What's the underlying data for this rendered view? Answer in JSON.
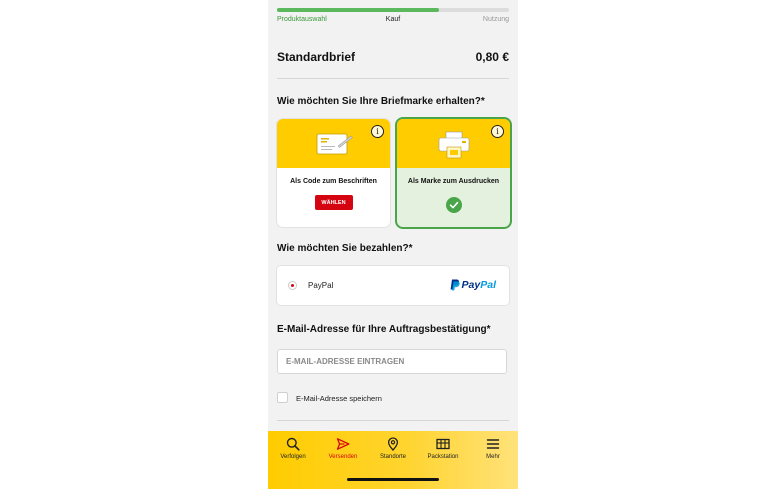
{
  "progress": {
    "fraction": 0.7,
    "steps": [
      "Produktauswahl",
      "Kauf",
      "Nutzung"
    ]
  },
  "product": {
    "name": "Standardbrief",
    "price": "0,80 €"
  },
  "delivery": {
    "heading": "Wie möchten Sie Ihre Briefmarke erhalten?*",
    "options": [
      {
        "title": "Als Code zum Beschriften",
        "button": "WÄHLEN",
        "selected": false,
        "icon": "envelope-code-illustration"
      },
      {
        "title": "Als Marke zum Ausdrucken",
        "selected": true,
        "icon": "printer-illustration"
      }
    ],
    "info_icon": "i"
  },
  "payment": {
    "heading": "Wie möchten Sie bezahlen?*",
    "method": "PayPal",
    "logo_part1": "Pay",
    "logo_part2": "Pal"
  },
  "email": {
    "heading": "E-Mail-Adresse für Ihre Auftragsbestätigung*",
    "placeholder": "E-MAIL-ADRESSE EINTRAGEN",
    "save_label": "E-Mail-Adresse speichern"
  },
  "tabbar": {
    "items": [
      {
        "label": "Verfolgen",
        "icon": "search-icon",
        "active": false
      },
      {
        "label": "Versenden",
        "icon": "send-icon",
        "active": true
      },
      {
        "label": "Standorte",
        "icon": "location-pin-icon",
        "active": false
      },
      {
        "label": "Packstation",
        "icon": "packstation-icon",
        "active": false
      },
      {
        "label": "Mehr",
        "icon": "menu-icon",
        "active": false
      }
    ]
  },
  "colors": {
    "brand_yellow": "#ffcc00",
    "brand_red": "#d40511",
    "success_green": "#4aa54a",
    "selected_bg": "#e4f1df"
  }
}
